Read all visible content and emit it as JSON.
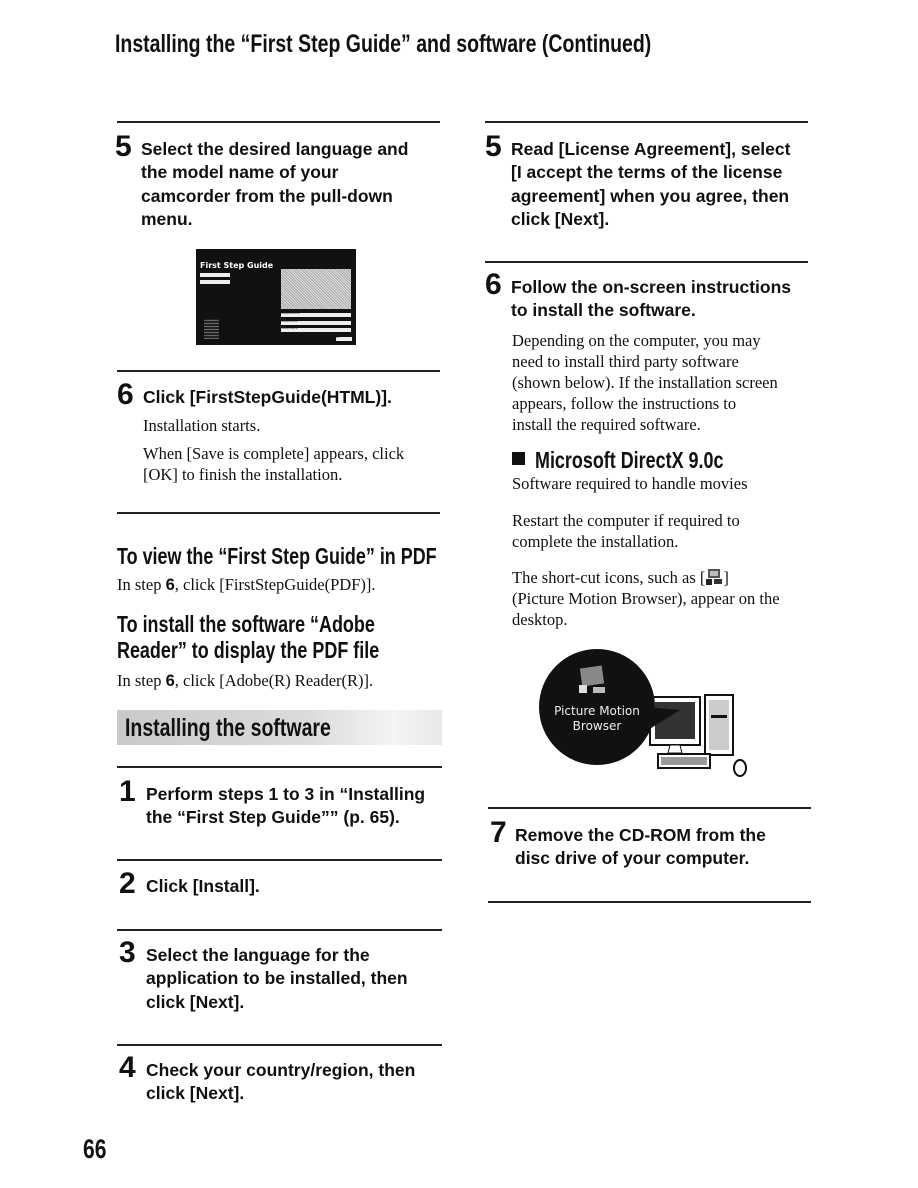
{
  "header": {
    "title": "Installing the “First Step Guide” and software (Continued)"
  },
  "left": {
    "step5": {
      "number": "5",
      "text": "Select the desired language and\nthe model name of your\ncamcorder from the pull-down\nmenu."
    },
    "screenshot": {
      "title": "First Step Guide",
      "buttons": [
        "FirstStepGuide(HTML)",
        "FirstStepGuide(PDF)",
        "Adobe(R) Reader(R)"
      ],
      "close_label": "Exit"
    },
    "step6": {
      "number": "6",
      "text": "Click [FirstStepGuide(HTML)].",
      "body1": "Installation starts.",
      "body2": "When [Save is complete] appears, click\n[OK] to finish the installation."
    },
    "pdf": {
      "heading": "To view the “First Step Guide” in PDF",
      "pre": "In step ",
      "bold": "6",
      "post": ", click [FirstStepGuide(PDF)]."
    },
    "adobe": {
      "heading": "To install the software “Adobe\nReader” to display the PDF file",
      "pre": "In step ",
      "bold": "6",
      "post": ", click [Adobe(R) Reader(R)]."
    },
    "banner": "Installing the software",
    "install_steps": [
      {
        "number": "1",
        "text": "Perform steps 1 to 3 in “Installing\nthe “First Step Guide”” (p. 65)."
      },
      {
        "number": "2",
        "text": "Click [Install]."
      },
      {
        "number": "3",
        "text": "Select the language for the\napplication to be installed, then\nclick [Next]."
      },
      {
        "number": "4",
        "text": "Check your country/region, then\nclick [Next]."
      }
    ]
  },
  "right": {
    "step5": {
      "number": "5",
      "text": "Read [License Agreement], select\n[I accept the terms of the license\nagreement] when you agree, then\nclick [Next]."
    },
    "step6": {
      "number": "6",
      "text": "Follow the on-screen instructions\nto install the software.",
      "body": "Depending on the computer, you may\nneed to install third party software\n(shown below). If the installation screen\nappears, follow the instructions to\ninstall the required software."
    },
    "directx": {
      "heading": "Microsoft DirectX 9.0c",
      "body": "Software required to handle movies"
    },
    "restart": "Restart the computer if required to\ncomplete the installation.",
    "shortcut": {
      "pre": "The short-cut icons, such as [",
      "post": "]\n(Picture Motion Browser), appear on the\ndesktop."
    },
    "illustration": {
      "line1": "Picture Motion",
      "line2": "Browser"
    },
    "step7": {
      "number": "7",
      "text": "Remove the CD-ROM from the\ndisc drive of your computer."
    }
  },
  "footer": {
    "page_number": "66"
  }
}
